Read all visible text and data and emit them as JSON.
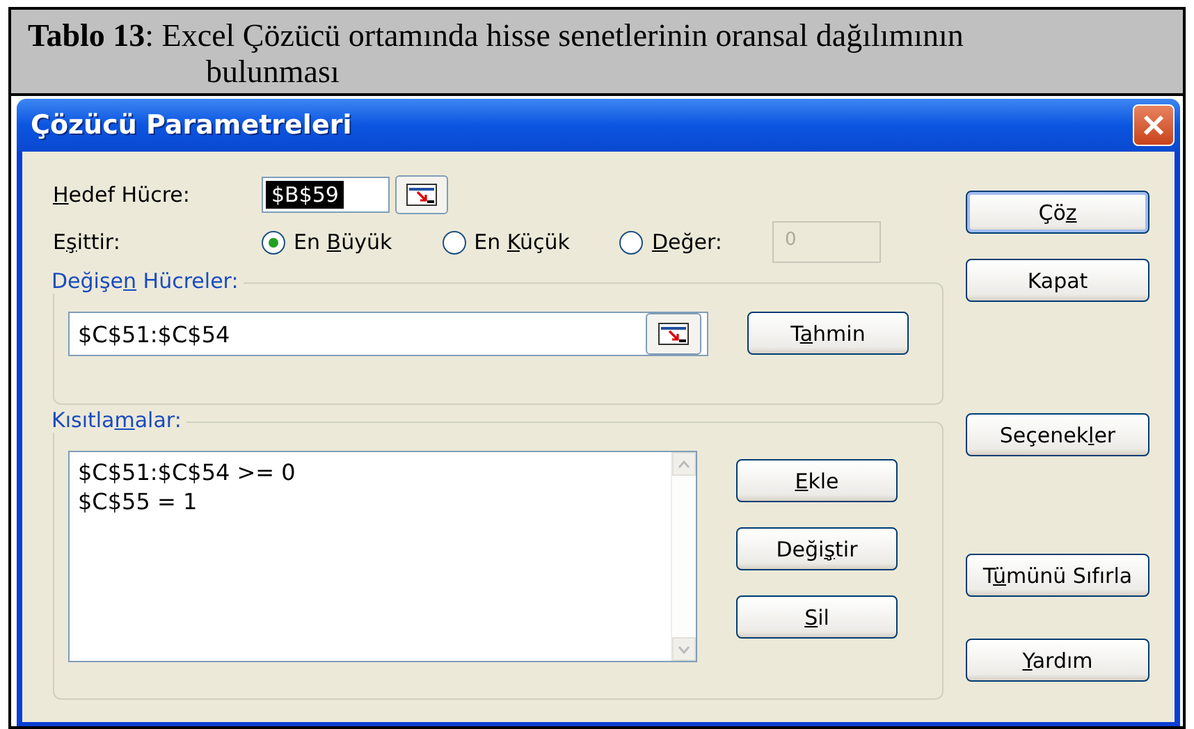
{
  "caption": {
    "label": "Tablo 13",
    "text": ": Excel Çözücü ortamında hisse senetlerinin oransal dağılımının",
    "text_line_2": "bulunması"
  },
  "window": {
    "title": "Çözücü Parametreleri"
  },
  "target": {
    "label": {
      "key": "H",
      "post": "edef Hücre:"
    },
    "value": "$B$59"
  },
  "equals": {
    "label": {
      "pre": "E",
      "key": "ş",
      "post": "ittir:"
    },
    "options": [
      {
        "label": {
          "pre": "En ",
          "key": "B",
          "post": "üyük"
        },
        "selected": true
      },
      {
        "label": {
          "pre": "En ",
          "key": "K",
          "post": "üçük"
        },
        "selected": false
      },
      {
        "label": {
          "key": "D",
          "post": "eğer:"
        },
        "selected": false
      }
    ],
    "value_field": {
      "value": "0",
      "disabled": true
    }
  },
  "changing_cells": {
    "label": {
      "pre": "Değişe",
      "key": "n",
      "post": " Hücreler:"
    },
    "value": "$C$51:$C$54",
    "button": {
      "pre": "T",
      "key": "a",
      "post": "hmin"
    }
  },
  "constraints": {
    "label": {
      "pre": "Kısıtla",
      "key": "m",
      "post": "alar:"
    },
    "items": [
      "$C$51:$C$54 >= 0",
      "$C$55 = 1"
    ],
    "buttons": [
      {
        "key": "E",
        "post": "kle"
      },
      {
        "pre": "Deği",
        "key": "ş",
        "post": "tir"
      },
      {
        "key": "S",
        "post": "il"
      }
    ]
  },
  "side_buttons": [
    {
      "label": {
        "pre": "Çö",
        "key": "z"
      },
      "default": true
    },
    {
      "label": {
        "post": "Kapat"
      },
      "default": false
    },
    {
      "label": {
        "pre": "Seçenek",
        "key": "l",
        "post": "er"
      },
      "default": false
    },
    {
      "label": {
        "pre": "T",
        "key": "ü",
        "post": "münü Sıfırla"
      },
      "default": false
    },
    {
      "label": {
        "key": "Y",
        "post": "ardım"
      },
      "default": false
    }
  ]
}
